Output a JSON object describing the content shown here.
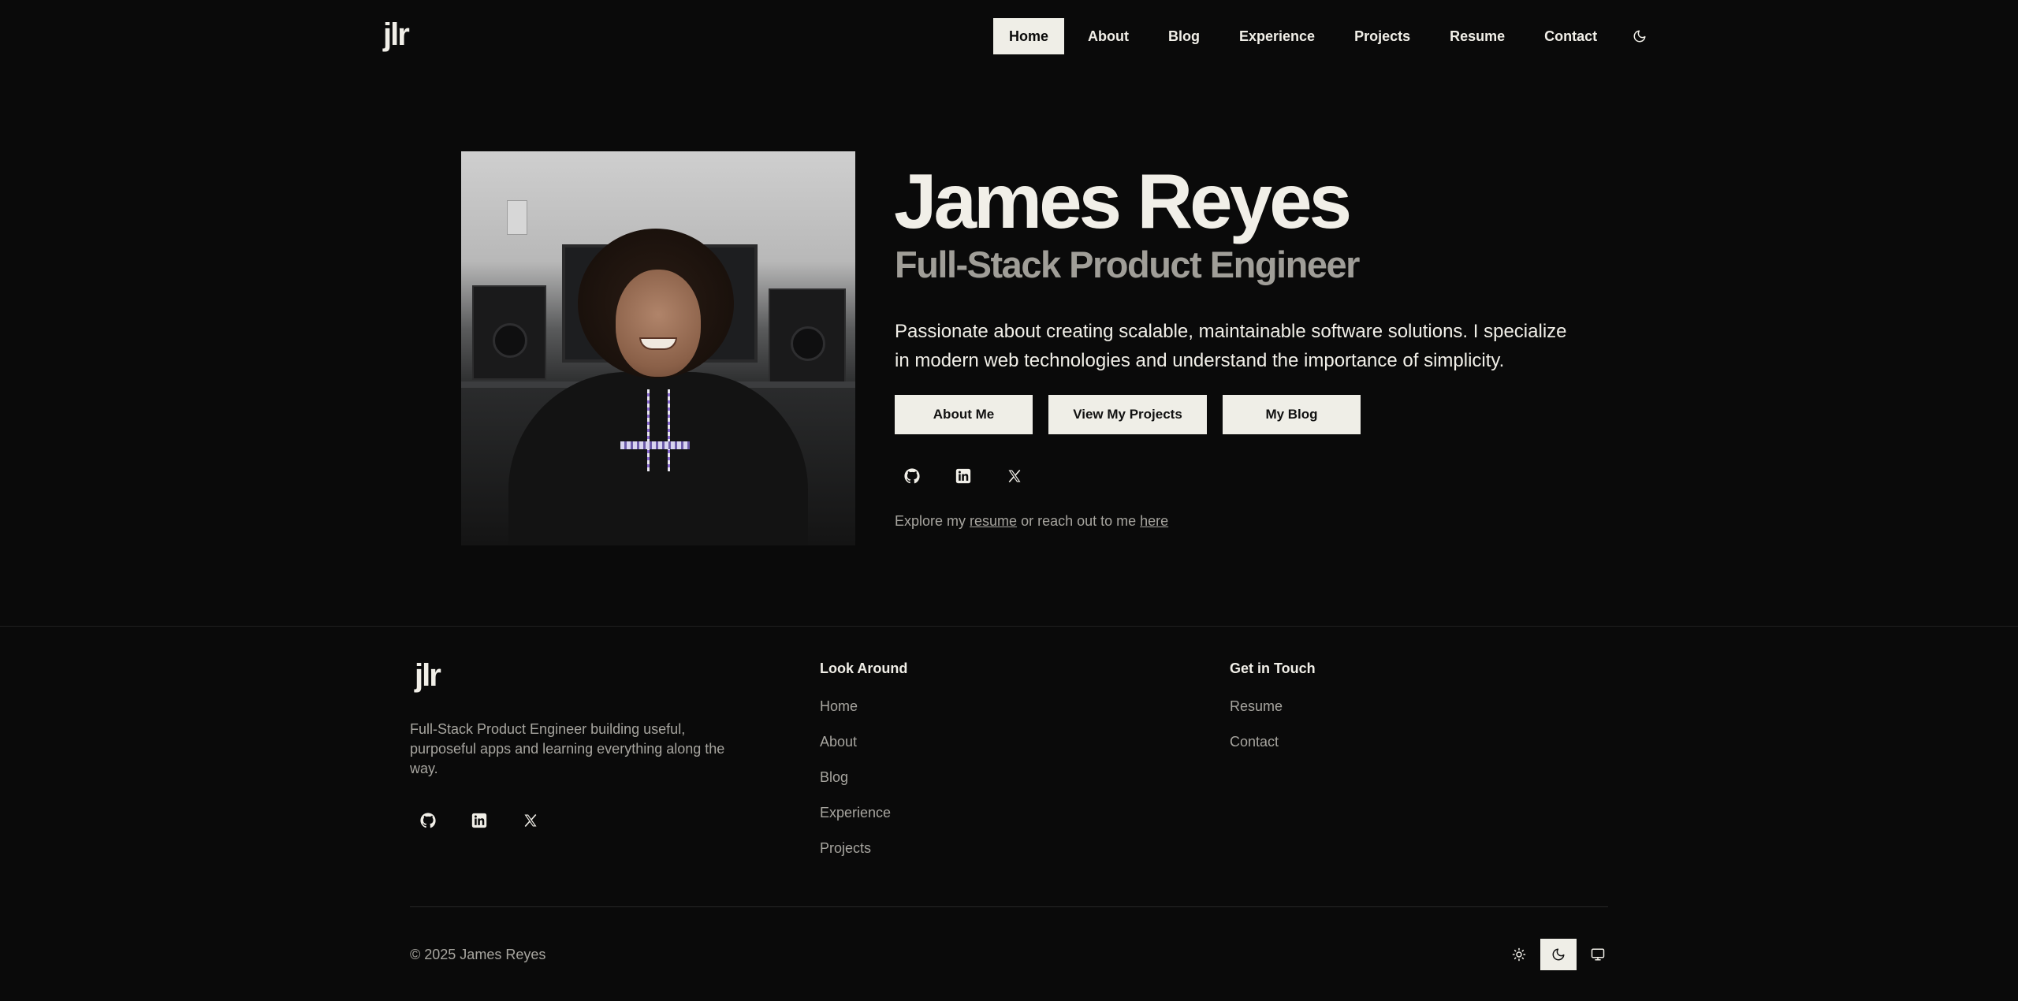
{
  "header": {
    "logo": "jlr",
    "nav": [
      {
        "label": "Home",
        "active": true
      },
      {
        "label": "About"
      },
      {
        "label": "Blog"
      },
      {
        "label": "Experience"
      },
      {
        "label": "Projects"
      },
      {
        "label": "Resume"
      },
      {
        "label": "Contact"
      }
    ],
    "theme_icon": "moon-icon"
  },
  "hero": {
    "photo_icon": "profile-photo",
    "name": "James Reyes",
    "role": "Full-Stack Product Engineer",
    "description": "Passionate about creating scalable, maintainable software solutions. I specialize in modern web technologies and understand the importance of simplicity.",
    "buttons": [
      "About Me",
      "View My Projects",
      "My Blog"
    ],
    "social_icons": [
      "github-icon",
      "linkedin-icon",
      "x-icon"
    ],
    "explore": {
      "prefix": "Explore my ",
      "resume_link": "resume",
      "middle": " or reach out to me ",
      "here_link": "here"
    }
  },
  "footer": {
    "logo": "jlr",
    "description": "Full-Stack Product Engineer building useful, purposeful apps and learning everything along the way.",
    "social_icons": [
      "github-icon",
      "linkedin-icon",
      "x-icon"
    ],
    "look_around": {
      "title": "Look Around",
      "links": [
        "Home",
        "About",
        "Blog",
        "Experience",
        "Projects"
      ]
    },
    "get_in_touch": {
      "title": "Get in Touch",
      "links": [
        "Resume",
        "Contact"
      ]
    },
    "copyright": "© 2025 James Reyes",
    "theme_options": [
      {
        "icon": "sun-icon"
      },
      {
        "icon": "moon-icon",
        "active": true
      },
      {
        "icon": "monitor-icon"
      }
    ]
  },
  "colors": {
    "background": "#0a0a0a",
    "text": "#f1efe8",
    "muted": "#a7a59f",
    "button_bg": "#efeee7"
  }
}
